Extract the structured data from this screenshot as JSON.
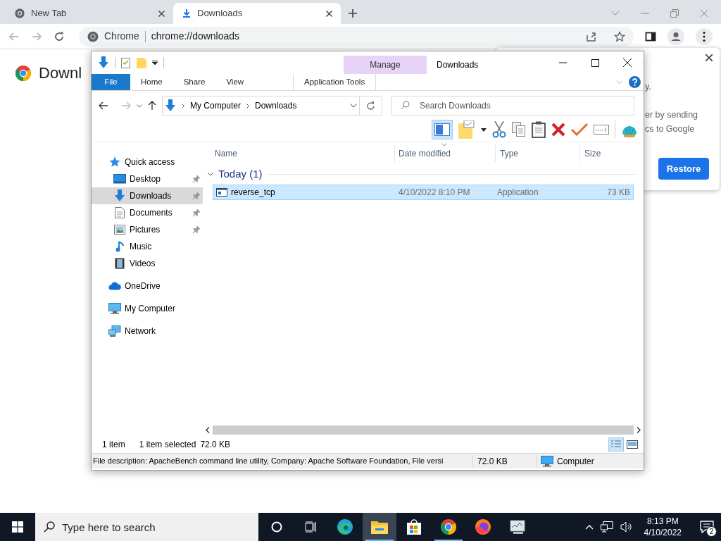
{
  "browser": {
    "tabs": [
      {
        "kind": "newtab",
        "title": "New Tab",
        "selected": false
      },
      {
        "kind": "downloads",
        "title": "Downloads",
        "selected": true
      }
    ],
    "omnibox": {
      "site_label": "Chrome",
      "url": "chrome://downloads"
    },
    "page": {
      "heading": "Downl"
    },
    "popup": {
      "text_lines": [
        "y.",
        "er by sending",
        "cs to Google"
      ],
      "button": "Restore"
    }
  },
  "explorer": {
    "title": "Downloads",
    "contextual_group": "Manage",
    "ribbon_tabs": [
      {
        "kind": "file",
        "label": "File"
      },
      {
        "kind": "plain",
        "label": "Home"
      },
      {
        "kind": "plain",
        "label": "Share"
      },
      {
        "kind": "plain",
        "label": "View"
      },
      {
        "kind": "contextual",
        "label": "Application Tools"
      }
    ],
    "breadcrumbs": [
      "My Computer",
      "Downloads"
    ],
    "search": {
      "placeholder": "Search Downloads"
    },
    "nav": [
      {
        "label": "Quick access",
        "selected": false,
        "children": [
          {
            "label": "Desktop",
            "pinned": true,
            "selected": false
          },
          {
            "label": "Downloads",
            "pinned": true,
            "selected": true
          },
          {
            "label": "Documents",
            "pinned": true,
            "selected": false
          },
          {
            "label": "Pictures",
            "pinned": true,
            "selected": false
          },
          {
            "label": "Music",
            "pinned": false,
            "selected": false
          },
          {
            "label": "Videos",
            "pinned": false,
            "selected": false
          }
        ]
      },
      {
        "label": "OneDrive",
        "selected": false
      },
      {
        "label": "My Computer",
        "selected": false
      },
      {
        "label": "Network",
        "selected": false
      }
    ],
    "columns": [
      "Name",
      "Date modified",
      "Type",
      "Size"
    ],
    "groups": [
      {
        "label": "Today (1)",
        "expanded": true,
        "rows": [
          {
            "name": "reverse_tcp",
            "date": "4/10/2022 8:10 PM",
            "type": "Application",
            "size": "73 KB",
            "selected": true
          }
        ]
      }
    ],
    "status": {
      "count": "1 item",
      "selection": "1 item selected",
      "selection_size": "72.0 KB"
    },
    "details": {
      "description": "File description: ApacheBench command line utility, Company: Apache Software Foundation, File versi",
      "size": "72.0 KB",
      "location": "Computer"
    }
  },
  "taskbar": {
    "search_placeholder": "Type here to search",
    "apps": [
      {
        "kind": "cortana",
        "running": false,
        "active": false
      },
      {
        "kind": "taskview",
        "running": false,
        "active": false
      },
      {
        "kind": "edge",
        "running": false,
        "active": false
      },
      {
        "kind": "explorer",
        "running": true,
        "active": true
      },
      {
        "kind": "store",
        "running": false,
        "active": false
      },
      {
        "kind": "chrome",
        "running": true,
        "active": false
      },
      {
        "kind": "firefox",
        "running": false,
        "active": false
      },
      {
        "kind": "monitor",
        "running": false,
        "active": false
      }
    ],
    "time": "8:13 PM",
    "date": "4/10/2022",
    "notifications": "2"
  }
}
